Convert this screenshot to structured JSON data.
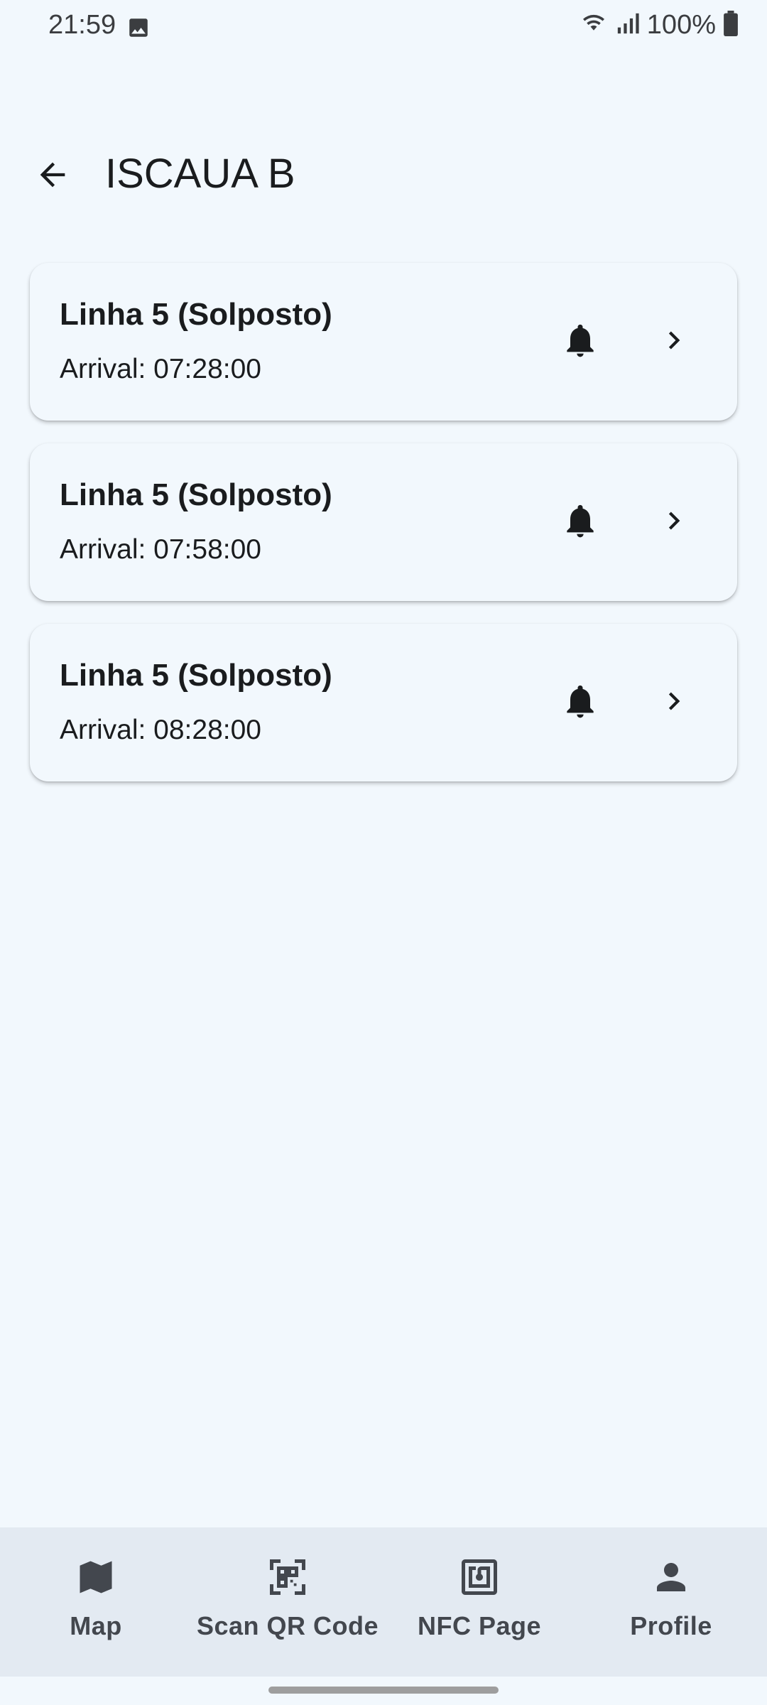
{
  "status_bar": {
    "time": "21:59",
    "battery": "100%"
  },
  "header": {
    "title": "ISCAUA B"
  },
  "arrivals": [
    {
      "line": "Linha 5 (Solposto)",
      "arrival": "Arrival: 07:28:00"
    },
    {
      "line": "Linha 5 (Solposto)",
      "arrival": "Arrival: 07:58:00"
    },
    {
      "line": "Linha 5 (Solposto)",
      "arrival": "Arrival: 08:28:00"
    }
  ],
  "bottom_nav": {
    "items": [
      {
        "label": "Map",
        "icon": "map-icon"
      },
      {
        "label": "Scan QR Code",
        "icon": "qr-code-icon"
      },
      {
        "label": "NFC Page",
        "icon": "nfc-icon"
      },
      {
        "label": "Profile",
        "icon": "person-icon"
      }
    ]
  },
  "colors": {
    "background": "#f2f8fd",
    "nav_background": "#e3eaf2",
    "text": "#1a1c1e"
  }
}
